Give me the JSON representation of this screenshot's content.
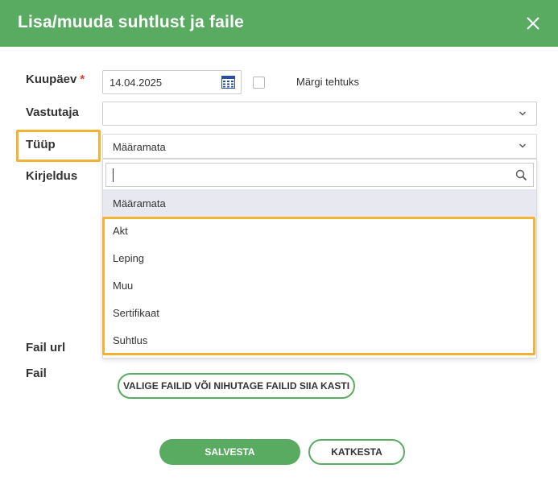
{
  "dialog": {
    "title": "Lisa/muuda suhtlust ja faile"
  },
  "form": {
    "date_label": "Kuupäev",
    "required_mark": "*",
    "date_value": "14.04.2025",
    "mark_done_label": "Märgi tehtuks",
    "responsible_label": "Vastutaja",
    "type_label": "Tüüp",
    "type_value": "Määramata",
    "description_label": "Kirjeldus",
    "file_url_label": "Fail url",
    "file_label": "Fail"
  },
  "type_dropdown": {
    "search_value": "",
    "options": [
      "Määramata",
      "Akt",
      "Leping",
      "Muu",
      "Sertifikaat",
      "Suhtlus"
    ],
    "selected_index": 0
  },
  "buttons": {
    "upload": "VALIGE FAILID VÕI NIHUTAGE FAILID SIIA KASTI",
    "save": "SALVESTA",
    "cancel": "KATKESTA"
  },
  "colors": {
    "header": "#5aab62",
    "highlight": "#f2b233",
    "required": "#e03a3a",
    "selected_option": "#e8e9f0"
  },
  "icons": [
    "close-icon",
    "calendar-icon",
    "chevron-down-icon",
    "search-icon"
  ]
}
